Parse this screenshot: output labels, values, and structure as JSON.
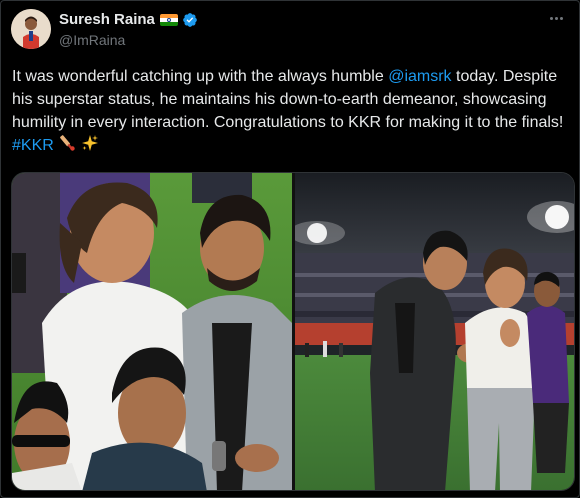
{
  "author": {
    "name": "Suresh Raina",
    "handle": "@ImRaina",
    "flag": "india-flag",
    "verified": "verified-badge-icon"
  },
  "tweet": {
    "text_before": "It was wonderful catching up with the always humble ",
    "mention": "@iamsrk",
    "text_after": " today. Despite his superstar status, he maintains his down-to-earth demeanor, showcasing humility in every interaction. Congratulations to KKR for making it to the finals! ",
    "hashtag": "#KKR",
    "emojis": [
      "cricket-bat-icon",
      "sparkles-icon"
    ]
  },
  "media": {
    "photos": [
      "photo-left",
      "photo-right"
    ]
  },
  "colors": {
    "background": "#000000",
    "text": "#e7e9ea",
    "secondary": "#71767b",
    "link": "#1d9bf0",
    "border": "#2f3336"
  }
}
